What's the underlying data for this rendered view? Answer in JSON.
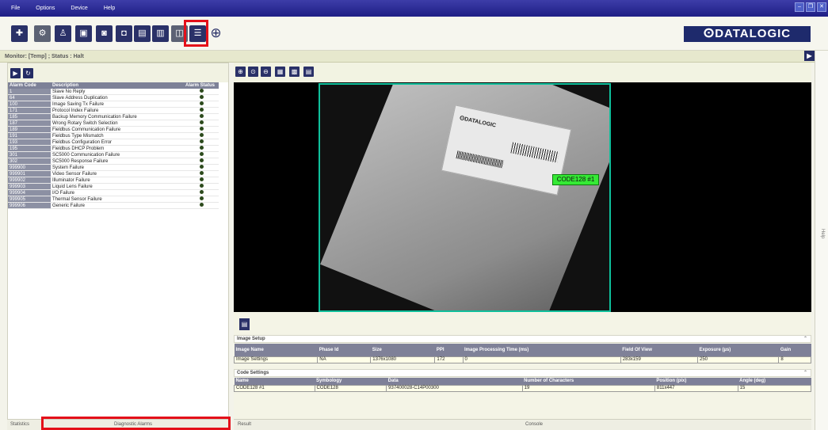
{
  "menu": [
    "File",
    "Options",
    "Device",
    "Help"
  ],
  "window_buttons": [
    "–",
    "❐",
    "✕"
  ],
  "brand": "ⵙDATALOGIC",
  "monitor": {
    "text": "Monitor:  [Temp] ;  Status :  Halt"
  },
  "alarm_table": {
    "headers": [
      "Alarm Code",
      "Description",
      "Alarm Status"
    ],
    "rows": [
      {
        "code": "1",
        "desc": "Slave No Reply"
      },
      {
        "code": "64",
        "desc": "Slave Address Duplication"
      },
      {
        "code": "100",
        "desc": "Image Saving Tx Failure"
      },
      {
        "code": "171",
        "desc": "Protocol Index Failure"
      },
      {
        "code": "185",
        "desc": "Backup Memory Communication Failure"
      },
      {
        "code": "187",
        "desc": "Wrong Rotary Switch Selection"
      },
      {
        "code": "189",
        "desc": "Fieldbus Communication Failure"
      },
      {
        "code": "191",
        "desc": "Fieldbus Type Mismatch"
      },
      {
        "code": "193",
        "desc": "Fieldbus Configuration Error"
      },
      {
        "code": "195",
        "desc": "Fieldbus DHCP Problem"
      },
      {
        "code": "301",
        "desc": "SC5000 Communication Failure"
      },
      {
        "code": "302",
        "desc": "SC5000 Response Failure"
      },
      {
        "code": "999900",
        "desc": "System Failure"
      },
      {
        "code": "999901",
        "desc": "Video Sensor Failure"
      },
      {
        "code": "999902",
        "desc": "Illuminator Failure"
      },
      {
        "code": "999903",
        "desc": "Liquid Lens Failure"
      },
      {
        "code": "999904",
        "desc": "I/O Failure"
      },
      {
        "code": "999905",
        "desc": "Thermal Sensor Failure"
      },
      {
        "code": "999906",
        "desc": "Generic Failure"
      }
    ]
  },
  "left_tabs": {
    "statistics": "Statistics",
    "diagnostic": "Diagnostic Alarms"
  },
  "image": {
    "code_label": "CODE128 #1",
    "sticker_brand": "ⵙDATALOGIC"
  },
  "image_setup": {
    "title": "Image Setup",
    "headers": [
      "Image Name",
      "Phase Id",
      "Size",
      "PPI",
      "Image Processing Time (ms)",
      "Field Of View",
      "Exposure (µs)",
      "Gain"
    ],
    "row": [
      "Image Settings",
      "NA",
      "1376x1080",
      "172",
      "0",
      "283x159",
      "250",
      "8"
    ]
  },
  "code_settings": {
    "title": "Code Settings",
    "headers": [
      "Name",
      "Symbology",
      "Data",
      "Number of Characters",
      "Position (pix)",
      "Angle (deg)"
    ],
    "row": [
      "CODE128 #1",
      "CODE128",
      "937400028-C14P00300",
      "19",
      "811x447",
      "15"
    ]
  },
  "right_tabs": {
    "result": "Result",
    "console": "Console"
  },
  "help_label": "Help",
  "colors": {
    "highlight": "#e4101a",
    "frame": "#0fbf9b",
    "code_box": "#35ea35",
    "menubar": "#1f1f86"
  }
}
